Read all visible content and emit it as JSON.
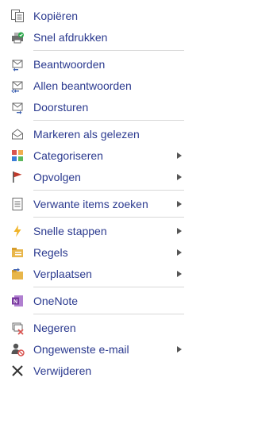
{
  "menu": {
    "items": [
      {
        "id": "kopieren",
        "label": "Kopiëren",
        "icon": "copy-icon",
        "submenu": false
      },
      {
        "id": "snel-afdrukken",
        "label": "Snel afdrukken",
        "icon": "quick-print-icon",
        "submenu": false
      },
      {
        "id": "beantwoorden",
        "label": "Beantwoorden",
        "icon": "reply-icon",
        "submenu": false
      },
      {
        "id": "allen-beantwoorden",
        "label": "Allen beantwoorden",
        "icon": "reply-all-icon",
        "submenu": false
      },
      {
        "id": "doorsturen",
        "label": "Doorsturen",
        "icon": "forward-icon",
        "submenu": false
      },
      {
        "id": "markeren",
        "label": "Markeren als gelezen",
        "icon": "mark-read-icon",
        "submenu": false
      },
      {
        "id": "categoriseren",
        "label": "Categoriseren",
        "icon": "categorize-icon",
        "submenu": true
      },
      {
        "id": "opvolgen",
        "label": "Opvolgen",
        "icon": "follow-up-flag-icon",
        "submenu": true
      },
      {
        "id": "verwante",
        "label": "Verwante items zoeken",
        "icon": "related-items-icon",
        "submenu": true
      },
      {
        "id": "snelle-stappen",
        "label": "Snelle stappen",
        "icon": "quick-steps-icon",
        "submenu": true
      },
      {
        "id": "regels",
        "label": "Regels",
        "icon": "rules-icon",
        "submenu": true
      },
      {
        "id": "verplaatsen",
        "label": "Verplaatsen",
        "icon": "move-folder-icon",
        "submenu": true
      },
      {
        "id": "onenote",
        "label": "OneNote",
        "icon": "onenote-icon",
        "submenu": false
      },
      {
        "id": "negeren",
        "label": "Negeren",
        "icon": "ignore-icon",
        "submenu": false
      },
      {
        "id": "ongewenste",
        "label": "Ongewenste e-mail",
        "icon": "junk-mail-icon",
        "submenu": true
      },
      {
        "id": "verwijderen",
        "label": "Verwijderen",
        "icon": "delete-icon",
        "submenu": false
      }
    ]
  },
  "colors": {
    "text": "#2b3a8f",
    "separator": "#d8d8d8",
    "flag": "#c0392b",
    "onenote": "#7a3aa0",
    "folder": "#e8b64a"
  }
}
